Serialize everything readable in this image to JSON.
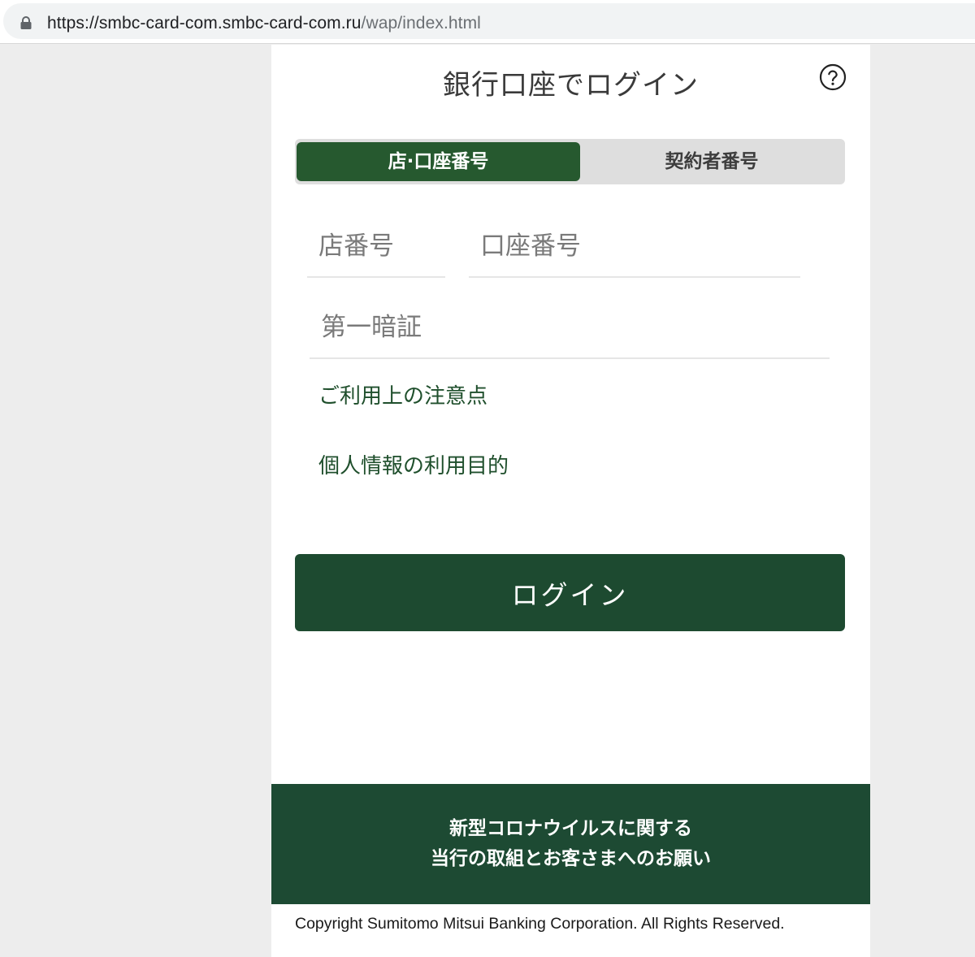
{
  "browser": {
    "url_host": "https://smbc-card-com.smbc-card-com.ru",
    "url_path": "/wap/index.html"
  },
  "page": {
    "title": "銀行口座でログイン",
    "help_icon": "question-circle-icon"
  },
  "tabs": [
    {
      "label": "店·口座番号",
      "active": true
    },
    {
      "label": "契約者番号",
      "active": false
    }
  ],
  "form": {
    "branch_placeholder": "店番号",
    "account_placeholder": "口座番号",
    "pin_placeholder": "第一暗証"
  },
  "links": {
    "usage_notes": "ご利用上の注意点",
    "privacy_purpose": "個人情報の利用目的"
  },
  "login_button": "ログイン",
  "banner": {
    "line1": "新型コロナウイルスに関する",
    "line2": "当行の取組とお客さまへのお願い"
  },
  "footer": {
    "copyright": "Copyright Sumitomo Mitsui Banking Corporation. All Rights Reserved."
  },
  "colors": {
    "brand_green": "#1d4a33",
    "tab_active": "#26592f",
    "link_green": "#1f4f2c"
  }
}
